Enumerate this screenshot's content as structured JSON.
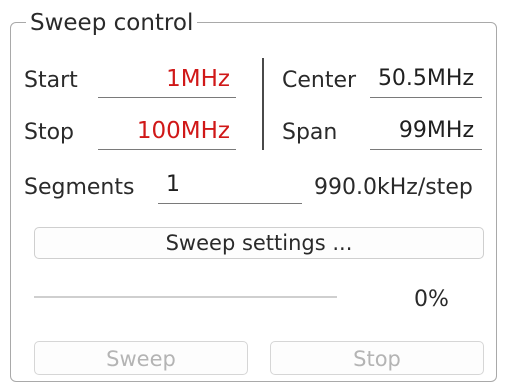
{
  "group": {
    "title": "Sweep control"
  },
  "start": {
    "label": "Start",
    "value": "1MHz"
  },
  "stop": {
    "label": "Stop",
    "value": "100MHz"
  },
  "center": {
    "label": "Center",
    "value": "50.5MHz"
  },
  "span": {
    "label": "Span",
    "value": "99MHz"
  },
  "segments": {
    "label": "Segments",
    "value": "1",
    "step": "990.0kHz/step"
  },
  "buttons": {
    "settings": "Sweep settings ...",
    "sweep": "Sweep",
    "stop": "Stop"
  },
  "progress": {
    "value": 0,
    "text": "0%"
  },
  "colors": {
    "value_red": "#d01818",
    "accent": "#3a7bd5"
  }
}
